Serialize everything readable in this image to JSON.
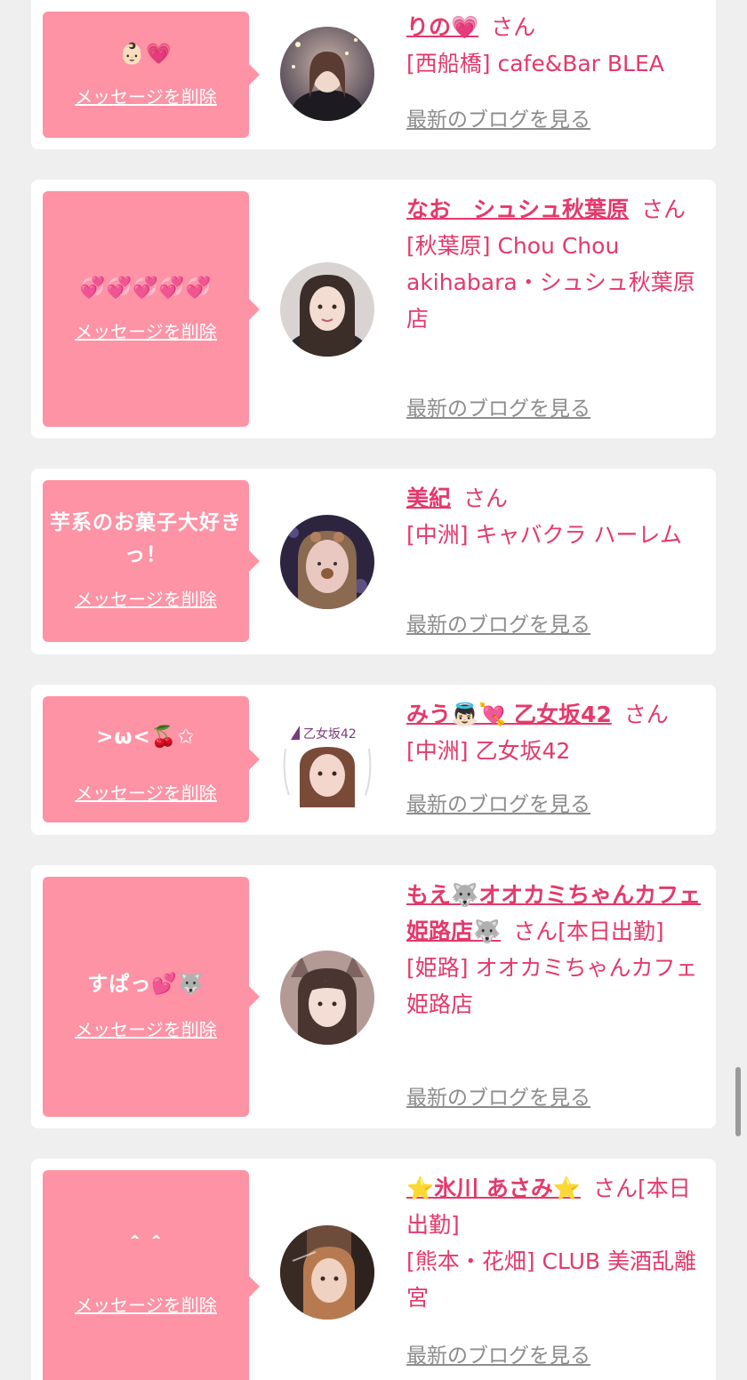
{
  "delete_label": "メッセージを削除",
  "blog_label": "最新のブログを見る",
  "san_label": "さん",
  "entries": [
    {
      "message": "👶🏻💗",
      "name": "りの💗",
      "suffix": "",
      "shop": "[西船橋] cafe&Bar BLEA"
    },
    {
      "message": "💞💞💞💞💞",
      "name": "なお　シュシュ秋葉原",
      "suffix": "",
      "shop": "[秋葉原] Chou Chou akihabara・シュシュ秋葉原店"
    },
    {
      "message": "芋系のお菓子大好きっ！",
      "name": "美紀",
      "suffix": "",
      "shop": "[中洲] キャバクラ ハーレム"
    },
    {
      "message": ">ω<🍒✩",
      "name": "みう👼🏻💘 乙女坂42",
      "suffix": "",
      "shop": "[中洲] 乙女坂42"
    },
    {
      "message": "すぱっ💕🐺",
      "name": "もえ🐺オオカミちゃんカフェ姫路店🐺",
      "suffix": "[本日出勤]",
      "shop": "[姫路] オオカミちゃんカフェ姫路店"
    },
    {
      "message": "＾＾",
      "name": "⭐氷川 あさみ⭐",
      "suffix": "[本日出勤]",
      "shop": "[熊本・花畑] CLUB 美酒乱離宮"
    }
  ],
  "colors": {
    "accent": "#e4396b",
    "bubble": "#fd93a5",
    "link_gray": "#8c8c8c",
    "background": "#efefef"
  }
}
